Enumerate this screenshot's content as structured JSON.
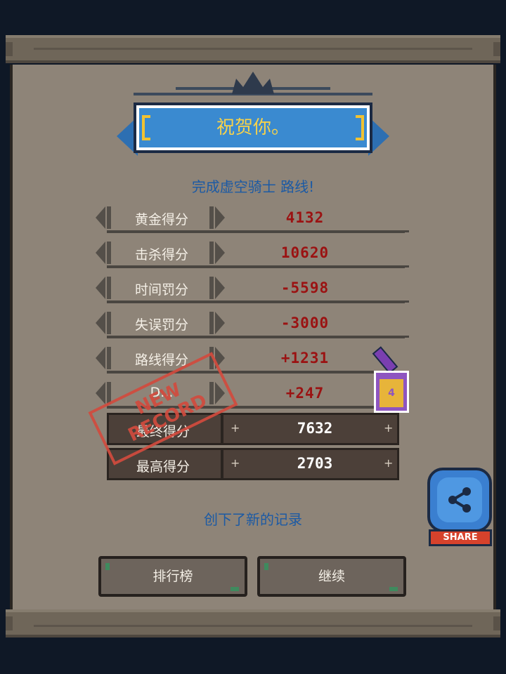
{
  "banner": {
    "title": "祝贺你。"
  },
  "route_message": "完成虚空骑士 路线!",
  "scores": [
    {
      "label": "黄金得分",
      "value": "4132"
    },
    {
      "label": "击杀得分",
      "value": "10620"
    },
    {
      "label": "时间罚分",
      "value": "-5598"
    },
    {
      "label": "失误罚分",
      "value": "-3000"
    },
    {
      "label": "路线得分",
      "value": "+1231"
    },
    {
      "label": "D...",
      "value": "+247"
    }
  ],
  "totals": [
    {
      "label": "最终得分",
      "value": "7632"
    },
    {
      "label": "最高得分",
      "value": "2703"
    }
  ],
  "stamp": {
    "line1": "NEW",
    "line2": "RECORD"
  },
  "record_message": "创下了新的记录",
  "buttons": {
    "leaderboard": "排行榜",
    "continue": "继续"
  },
  "share": {
    "label": "SHARE"
  },
  "badge": {
    "text": "4"
  },
  "colors": {
    "accent_blue": "#3a8ad0",
    "title_gold": "#f7d24a",
    "value_red": "#9b1212",
    "stamp_red": "#d24b3e"
  }
}
